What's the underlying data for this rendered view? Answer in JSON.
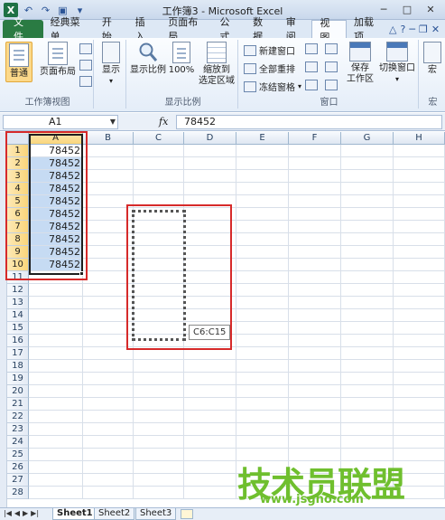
{
  "titlebar": {
    "title": "工作簿3 - Microsoft Excel",
    "logo": "X"
  },
  "tabs": [
    {
      "label": "文件"
    },
    {
      "label": "经典菜单"
    },
    {
      "label": "开始"
    },
    {
      "label": "插入"
    },
    {
      "label": "页面布局"
    },
    {
      "label": "公式"
    },
    {
      "label": "数据"
    },
    {
      "label": "审阅"
    },
    {
      "label": "视图"
    },
    {
      "label": "加载项"
    }
  ],
  "active_tab": "视图",
  "ribbon": {
    "workbook_views": {
      "label": "工作簿视图",
      "normal": "普通",
      "page_layout": "页面布局"
    },
    "show": {
      "label": "显示"
    },
    "zoom": {
      "label": "显示比例",
      "zoom": "显示比例",
      "hundred": "100%",
      "zoom_to_selection": "缩放到\n选定区域"
    },
    "window": {
      "label": "窗口",
      "new_window": "新建窗口",
      "arrange_all": "全部重排",
      "freeze_panes": "冻结窗格",
      "save_workspace": "保存\n工作区",
      "switch_windows": "切换窗口"
    },
    "macros": {
      "label": "宏"
    }
  },
  "formula_bar": {
    "name_box": "A1",
    "fx": "fx",
    "formula": "78452"
  },
  "grid": {
    "columns": [
      "A",
      "B",
      "C",
      "D",
      "E",
      "F",
      "G",
      "H"
    ],
    "rows": [
      "1",
      "2",
      "3",
      "4",
      "5",
      "6",
      "7",
      "8",
      "9",
      "10",
      "11",
      "12",
      "13",
      "14",
      "15",
      "16",
      "17",
      "18",
      "19",
      "20",
      "21",
      "22",
      "23",
      "24",
      "25",
      "26",
      "27",
      "28"
    ],
    "column_a_values": [
      "78452",
      "78452",
      "78452",
      "78452",
      "78452",
      "78452",
      "78452",
      "78452",
      "78452",
      "78452"
    ]
  },
  "tooltip": "C6:C15",
  "sheets": [
    "Sheet1",
    "Sheet2",
    "Sheet3"
  ],
  "active_sheet": "Sheet1",
  "watermark": {
    "text": "技术员联盟",
    "url": "www.jsgho.com"
  }
}
